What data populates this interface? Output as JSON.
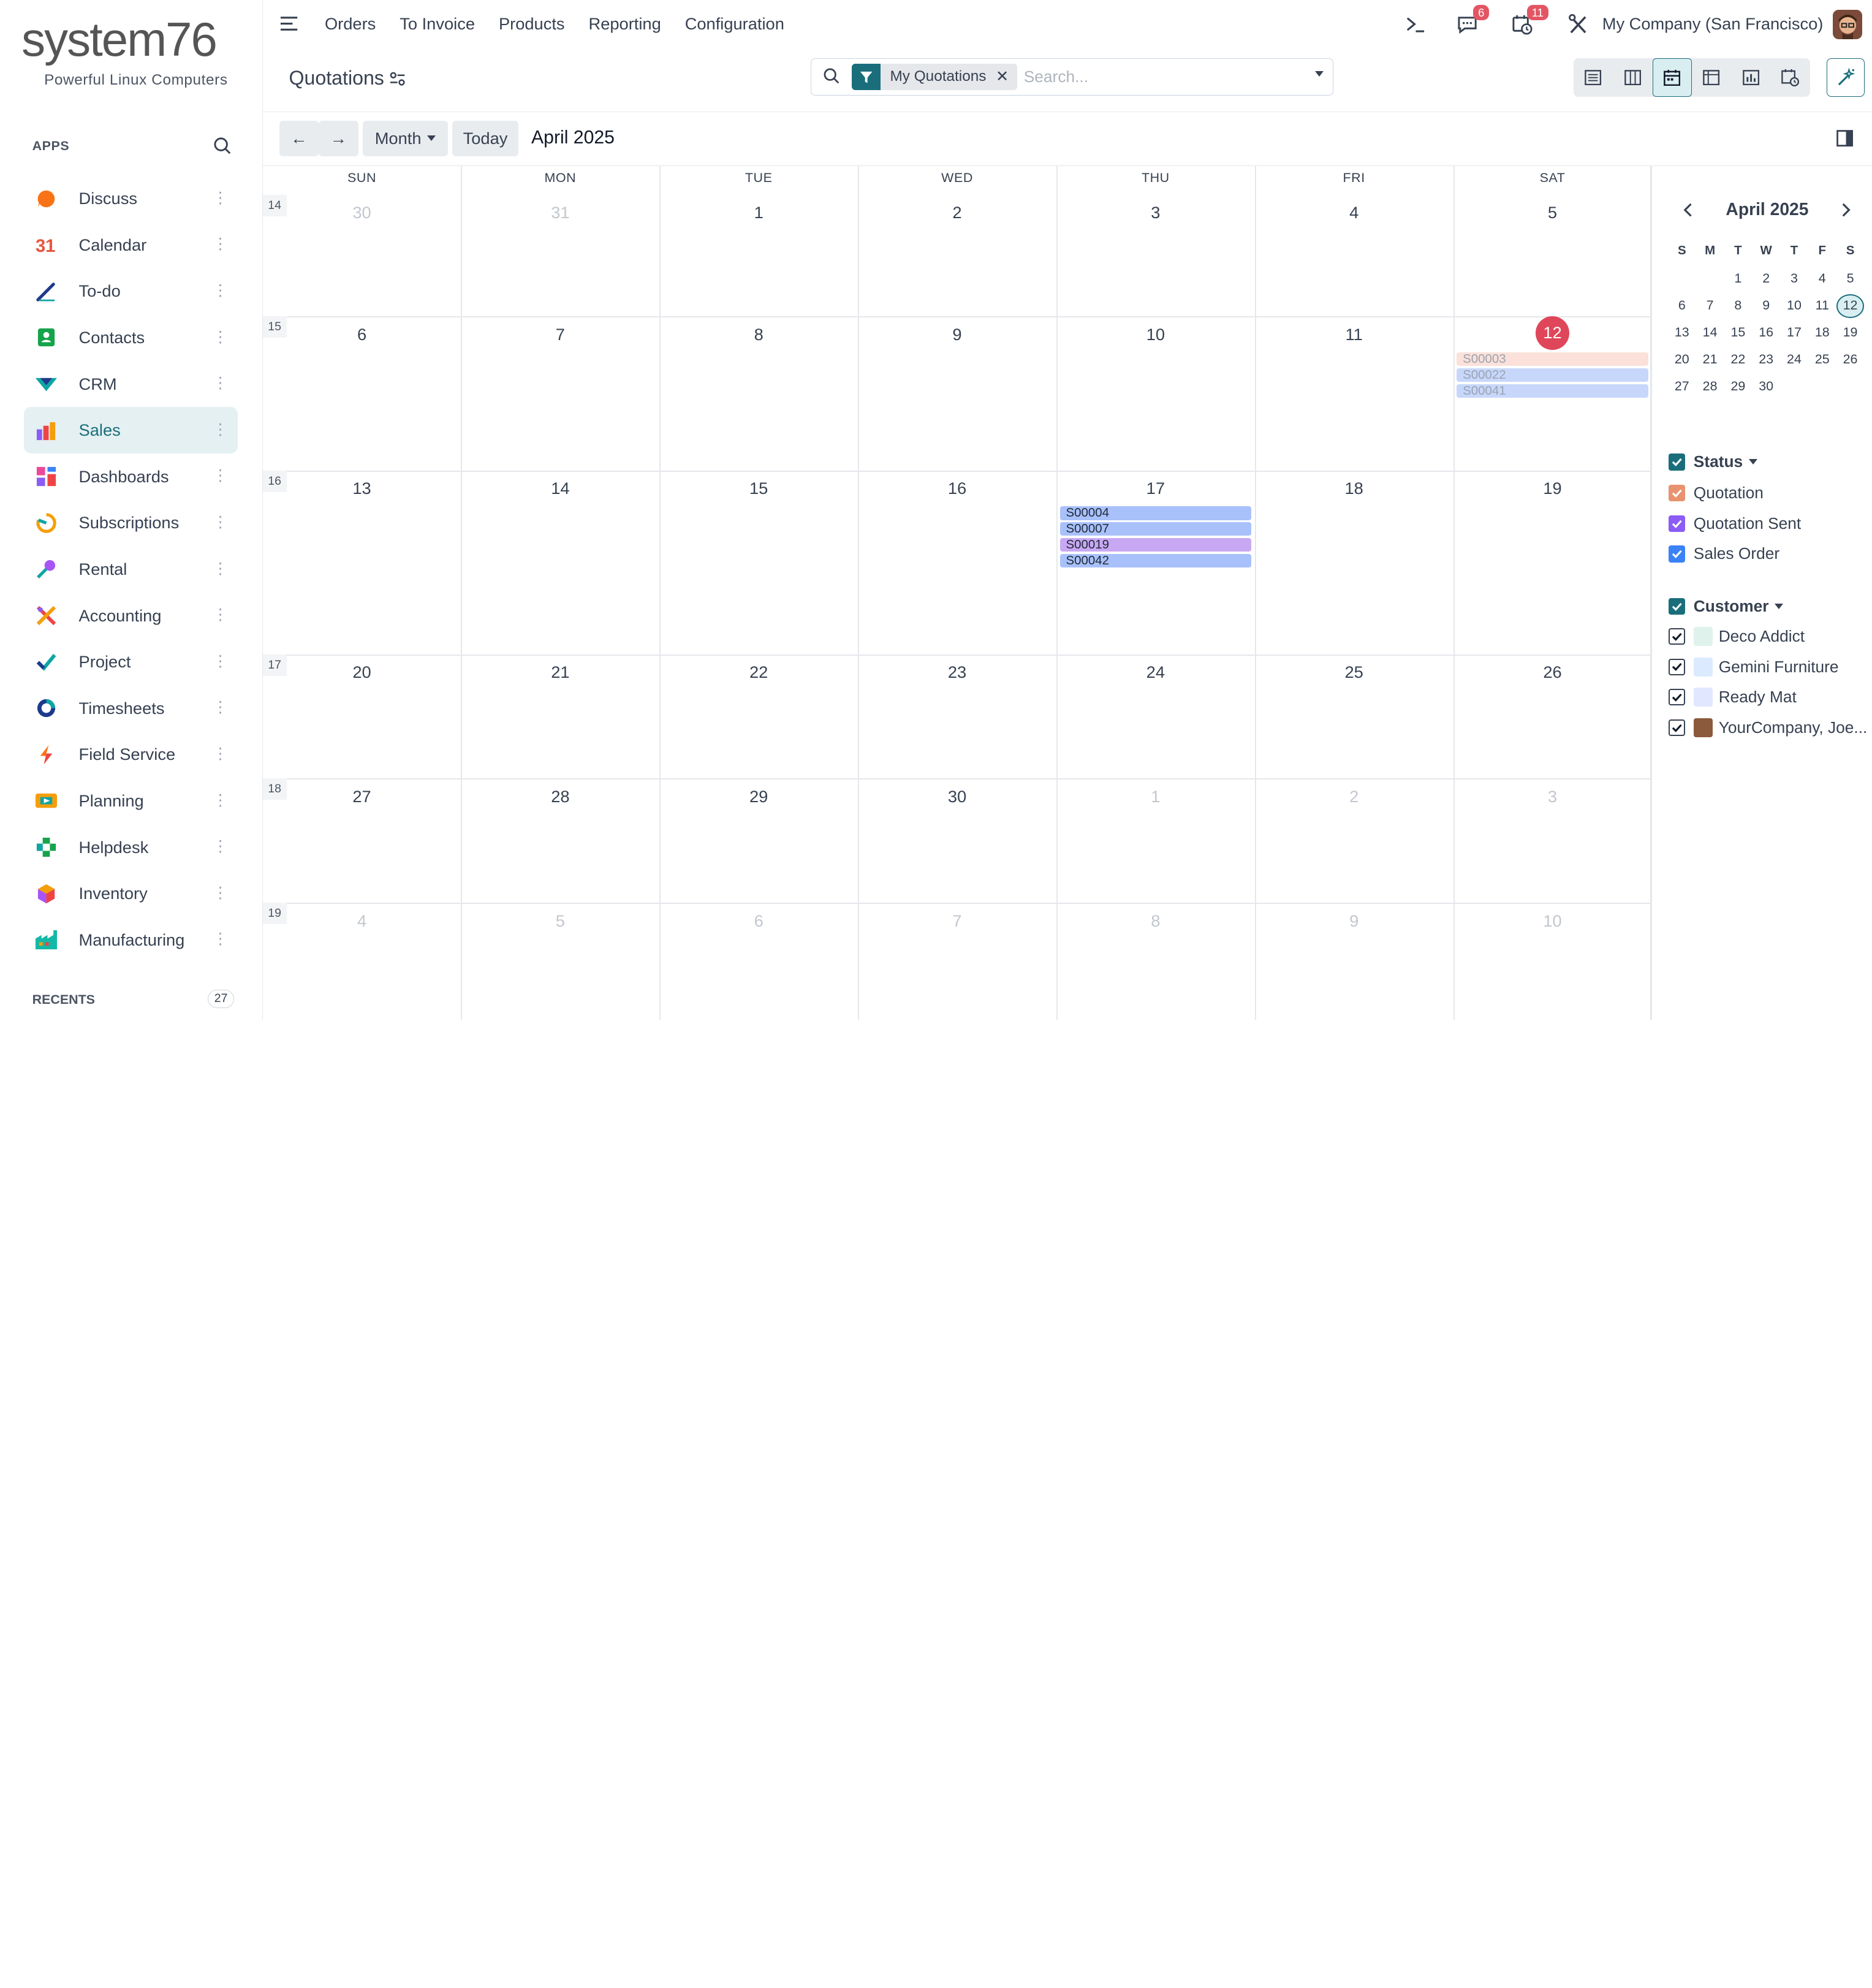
{
  "sidebar": {
    "logo": "system76",
    "tagline": "Powerful Linux Computers",
    "apps_header": "APPS",
    "apps": [
      {
        "label": "Discuss",
        "icon": "discuss-icon",
        "color": "#f97316"
      },
      {
        "label": "Calendar",
        "icon": "calendar-icon",
        "color": "#e8553c"
      },
      {
        "label": "To-do",
        "icon": "todo-icon",
        "color": "#1e3a8a"
      },
      {
        "label": "Contacts",
        "icon": "contacts-icon",
        "color": "#16a34a"
      },
      {
        "label": "CRM",
        "icon": "crm-icon",
        "color": "#0ea5a4"
      },
      {
        "label": "Sales",
        "icon": "sales-icon",
        "color": "#ef4444",
        "active": true
      },
      {
        "label": "Dashboards",
        "icon": "dashboards-icon",
        "color": "#ec4899"
      },
      {
        "label": "Subscriptions",
        "icon": "subscriptions-icon",
        "color": "#f59e0b"
      },
      {
        "label": "Rental",
        "icon": "rental-icon",
        "color": "#a855f7"
      },
      {
        "label": "Accounting",
        "icon": "accounting-icon",
        "color": "#ef4444"
      },
      {
        "label": "Project",
        "icon": "project-icon",
        "color": "#0ea5a4"
      },
      {
        "label": "Timesheets",
        "icon": "timesheets-icon",
        "color": "#1e3a8a"
      },
      {
        "label": "Field Service",
        "icon": "field-service-icon",
        "color": "#f97316"
      },
      {
        "label": "Planning",
        "icon": "planning-icon",
        "color": "#f59e0b"
      },
      {
        "label": "Helpdesk",
        "icon": "helpdesk-icon",
        "color": "#16a34a"
      },
      {
        "label": "Inventory",
        "icon": "inventory-icon",
        "color": "#a855f7"
      },
      {
        "label": "Manufacturing",
        "icon": "manufacturing-icon",
        "color": "#14b8a6"
      }
    ],
    "recents_label": "RECENTS",
    "recents_count": "27"
  },
  "topbar": {
    "nav": [
      "Orders",
      "To Invoice",
      "Products",
      "Reporting",
      "Configuration"
    ],
    "messages_badge": "6",
    "activities_badge": "11",
    "company": "My Company (San Francisco)"
  },
  "control": {
    "breadcrumb": "Quotations",
    "facet_value": "My Quotations",
    "search_placeholder": "Search..."
  },
  "calendar": {
    "prev_label": "←",
    "next_label": "→",
    "scale_label": "Month",
    "today_label": "Today",
    "period": "April 2025",
    "weekdays": [
      "SUN",
      "MON",
      "TUE",
      "WED",
      "THU",
      "FRI",
      "SAT"
    ],
    "weeks": [
      {
        "num": "14",
        "days": [
          {
            "d": "30",
            "o": true
          },
          {
            "d": "31",
            "o": true
          },
          {
            "d": "1"
          },
          {
            "d": "2"
          },
          {
            "d": "3"
          },
          {
            "d": "4"
          },
          {
            "d": "5"
          }
        ]
      },
      {
        "num": "15",
        "days": [
          {
            "d": "6"
          },
          {
            "d": "7"
          },
          {
            "d": "8"
          },
          {
            "d": "9"
          },
          {
            "d": "10"
          },
          {
            "d": "11"
          },
          {
            "d": "12",
            "today": true
          }
        ]
      },
      {
        "num": "16",
        "days": [
          {
            "d": "13"
          },
          {
            "d": "14"
          },
          {
            "d": "15"
          },
          {
            "d": "16"
          },
          {
            "d": "17"
          },
          {
            "d": "18"
          },
          {
            "d": "19"
          }
        ]
      },
      {
        "num": "17",
        "days": [
          {
            "d": "20"
          },
          {
            "d": "21"
          },
          {
            "d": "22"
          },
          {
            "d": "23"
          },
          {
            "d": "24"
          },
          {
            "d": "25"
          },
          {
            "d": "26"
          }
        ]
      },
      {
        "num": "18",
        "days": [
          {
            "d": "27"
          },
          {
            "d": "28"
          },
          {
            "d": "29"
          },
          {
            "d": "30"
          },
          {
            "d": "1",
            "o": true
          },
          {
            "d": "2",
            "o": true
          },
          {
            "d": "3",
            "o": true
          }
        ]
      },
      {
        "num": "19",
        "days": [
          {
            "d": "4",
            "o": true
          },
          {
            "d": "5",
            "o": true
          },
          {
            "d": "6",
            "o": true
          },
          {
            "d": "7",
            "o": true
          },
          {
            "d": "8",
            "o": true
          },
          {
            "d": "9",
            "o": true
          },
          {
            "d": "10",
            "o": true
          }
        ]
      }
    ],
    "events": [
      {
        "label": "S00003",
        "week": 1,
        "day": 6,
        "slot": 0,
        "bg": "#fbe1da",
        "fg": "#9ca3af"
      },
      {
        "label": "S00022",
        "week": 1,
        "day": 6,
        "slot": 1,
        "bg": "#c7d7fb",
        "fg": "#9ca3af"
      },
      {
        "label": "S00041",
        "week": 1,
        "day": 6,
        "slot": 2,
        "bg": "#c7d7fb",
        "fg": "#9ca3af"
      },
      {
        "label": "S00004",
        "week": 2,
        "day": 4,
        "slot": 0,
        "bg": "#a9c1fb",
        "fg": "#1f2937"
      },
      {
        "label": "S00007",
        "week": 2,
        "day": 4,
        "slot": 1,
        "bg": "#a9c1fb",
        "fg": "#1f2937"
      },
      {
        "label": "S00019",
        "week": 2,
        "day": 4,
        "slot": 2,
        "bg": "#c9a8f3",
        "fg": "#1f2937"
      },
      {
        "label": "S00042",
        "week": 2,
        "day": 4,
        "slot": 3,
        "bg": "#a9c1fb",
        "fg": "#1f2937"
      }
    ]
  },
  "mini_calendar": {
    "title": "April 2025",
    "weekday_initials": [
      "S",
      "M",
      "T",
      "W",
      "T",
      "F",
      "S"
    ],
    "rows": [
      [
        "",
        "",
        "1",
        "2",
        "3",
        "4",
        "5"
      ],
      [
        "6",
        "7",
        "8",
        "9",
        "10",
        "11",
        "12"
      ],
      [
        "13",
        "14",
        "15",
        "16",
        "17",
        "18",
        "19"
      ],
      [
        "20",
        "21",
        "22",
        "23",
        "24",
        "25",
        "26"
      ],
      [
        "27",
        "28",
        "29",
        "30",
        "",
        "",
        ""
      ]
    ],
    "today": "12"
  },
  "filters": {
    "status": {
      "title": "Status",
      "items": [
        {
          "label": "Quotation",
          "color": "#e9926f"
        },
        {
          "label": "Quotation Sent",
          "color": "#8b5cf6"
        },
        {
          "label": "Sales Order",
          "color": "#3b82f6"
        }
      ]
    },
    "customer": {
      "title": "Customer",
      "items": [
        {
          "label": "Deco Addict",
          "avatar": "#dff3ec"
        },
        {
          "label": "Gemini Furniture",
          "avatar": "#dbeafe"
        },
        {
          "label": "Ready Mat",
          "avatar": "#e0e7ff"
        },
        {
          "label": "YourCompany, Joe...",
          "avatar": "#8b5a3c"
        }
      ]
    },
    "accent": "#1a6e7b"
  }
}
